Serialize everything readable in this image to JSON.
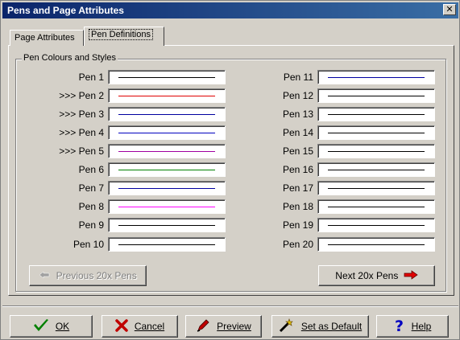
{
  "window": {
    "title": "Pens and Page Attributes",
    "close_glyph": "✕"
  },
  "tabs": [
    {
      "label": "Page Attributes",
      "active": false
    },
    {
      "label": "Pen Definitions",
      "active": true
    }
  ],
  "group_title": "Pen Colours and Styles",
  "pens": [
    {
      "label": "Pen 1",
      "color": "#000000"
    },
    {
      "label": ">>> Pen 2",
      "color": "#e00000"
    },
    {
      "label": ">>> Pen 3",
      "color": "#0000a0"
    },
    {
      "label": ">>> Pen 4",
      "color": "#0000c0"
    },
    {
      "label": ">>> Pen 5",
      "color": "#a000a0"
    },
    {
      "label": "Pen 6",
      "color": "#008000"
    },
    {
      "label": "Pen 7",
      "color": "#0000a0"
    },
    {
      "label": "Pen 8",
      "color": "#ff00ff"
    },
    {
      "label": "Pen 9",
      "color": "#000000"
    },
    {
      "label": "Pen 10",
      "color": "#000000"
    },
    {
      "label": "Pen 11",
      "color": "#0000a0"
    },
    {
      "label": "Pen 12",
      "color": "#000000"
    },
    {
      "label": "Pen 13",
      "color": "#000000"
    },
    {
      "label": "Pen 14",
      "color": "#000000"
    },
    {
      "label": "Pen 15",
      "color": "#000000"
    },
    {
      "label": "Pen 16",
      "color": "#000000"
    },
    {
      "label": "Pen 17",
      "color": "#000000"
    },
    {
      "label": "Pen 18",
      "color": "#000000"
    },
    {
      "label": "Pen 19",
      "color": "#000000"
    },
    {
      "label": "Pen 20",
      "color": "#000000"
    }
  ],
  "nav": {
    "prev_label": "Previous 20x Pens",
    "prev_icon": "left-arrow-icon",
    "prev_enabled": false,
    "next_label": "Next 20x Pens",
    "next_icon": "right-arrow-icon"
  },
  "footer": {
    "ok_label": "OK",
    "ok_icon": "checkmark-icon",
    "ok_color": "#008000",
    "cancel_label": "Cancel",
    "cancel_icon": "x-icon",
    "cancel_color": "#c00000",
    "preview_label": "Preview",
    "preview_icon": "pen-icon",
    "default_label": "Set as Default",
    "default_icon": "wand-icon",
    "help_label": "Help",
    "help_icon": "question-icon",
    "help_color": "#0000c0"
  }
}
